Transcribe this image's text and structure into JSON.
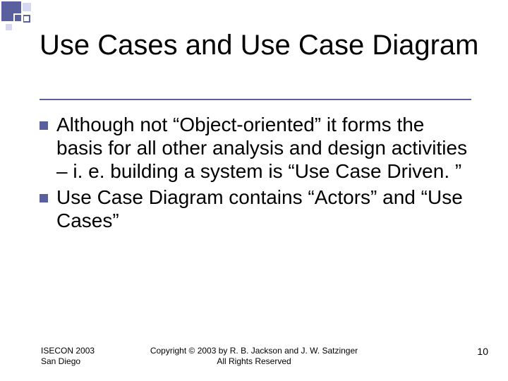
{
  "title": "Use Cases and Use Case Diagram",
  "bullets": [
    "Although not “Object-oriented” it forms the basis for all other analysis and design activities – i. e. building a system is “Use Case Driven. ”",
    "Use Case Diagram contains “Actors” and “Use Cases”"
  ],
  "footer": {
    "left_line1": "ISECON 2003",
    "left_line2": "San Diego",
    "center_line1": "Copyright © 2003 by R. B. Jackson  and J. W. Satzinger",
    "center_line2": "All Rights Reserved",
    "page_number": "10"
  },
  "decor": {
    "accent": "#5a5f9e",
    "light": "#d6d8f0"
  }
}
